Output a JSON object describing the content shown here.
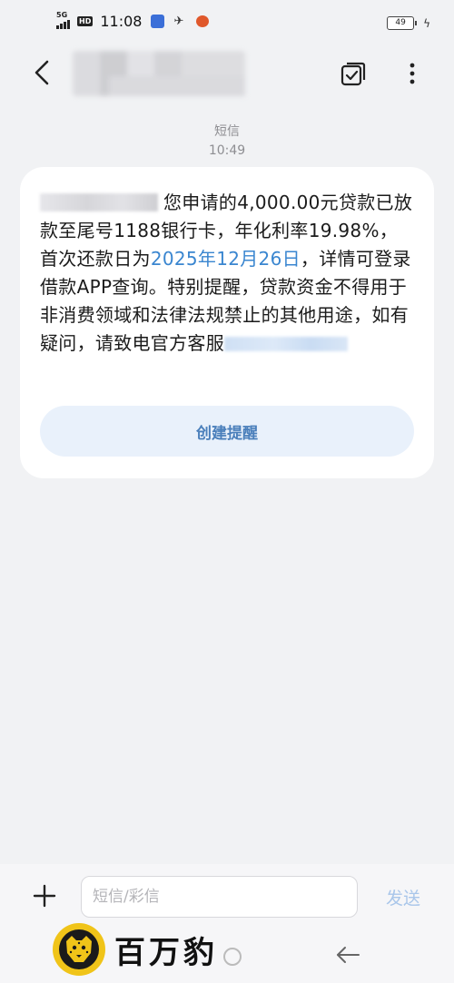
{
  "status_bar": {
    "network": "5G",
    "hd": "HD",
    "time": "11:08",
    "battery": "49",
    "icons": [
      "signal-icon",
      "hd-icon",
      "app-notification-icon",
      "bird-icon",
      "fire-icon",
      "battery-icon",
      "charging-icon"
    ]
  },
  "header": {
    "contact_name": "",
    "icons": [
      "back-arrow-icon",
      "select-check-icon",
      "more-vertical-icon"
    ]
  },
  "message": {
    "type_label": "短信",
    "time": "10:49",
    "text_before_date": "您申请的4,000.00元贷款已放款至尾号1188银行卡，年化利率19.98%，首次还款日为",
    "date_link": "2025年12月26日",
    "text_after_date": "，详情可登录借款APP查询。特别提醒，贷款资金不得用于非消费领域和法律法规禁止的其他用途，如有疑问，请致电官方客服",
    "reminder_button": "创建提醒"
  },
  "composer": {
    "placeholder": "短信/彩信",
    "value": "",
    "send_label": "发送",
    "icons": [
      "plus-icon"
    ]
  },
  "nav": {
    "icons": [
      "home-circle-icon",
      "back-nav-icon"
    ]
  },
  "watermark": {
    "text": "百万豹",
    "icons": [
      "leopard-logo-icon"
    ]
  },
  "colors": {
    "background": "#f1f2f4",
    "bubble": "#ffffff",
    "link": "#3a86d0",
    "reminder_bg": "#e9f1fb",
    "send_disabled": "#a9c6ea"
  }
}
